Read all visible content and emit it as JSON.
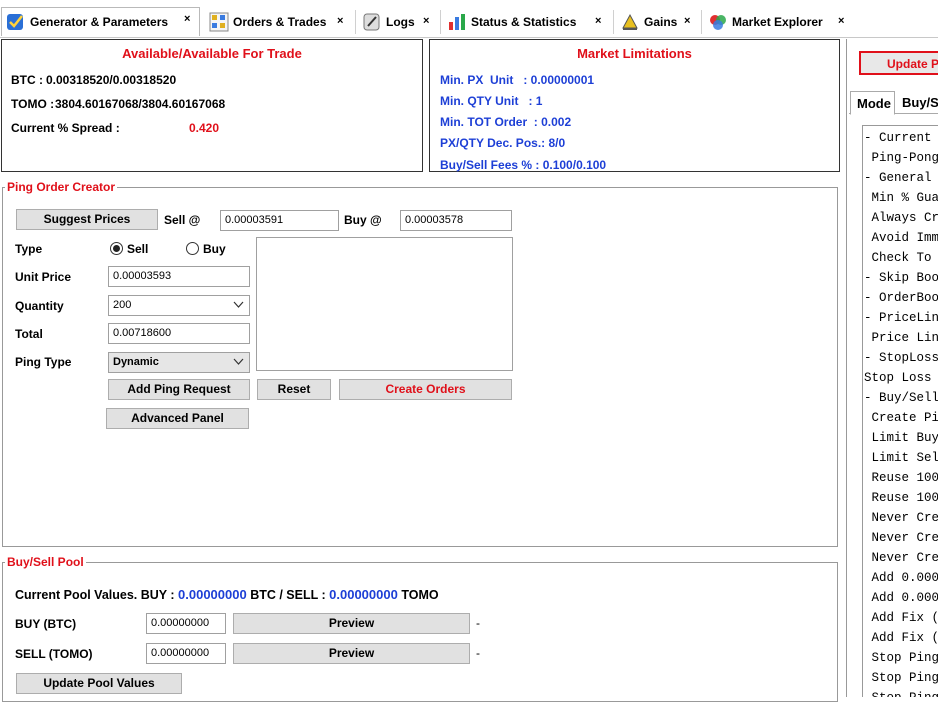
{
  "tabs": [
    {
      "label": "Generator & Parameters",
      "close": "×",
      "active": true,
      "icon": "generator-icon"
    },
    {
      "label": "Orders & Trades",
      "close": "×",
      "active": false,
      "icon": "orders-icon"
    },
    {
      "label": "Logs",
      "close": "×",
      "active": false,
      "icon": "logs-icon"
    },
    {
      "label": "Status & Statistics",
      "close": "×",
      "active": false,
      "icon": "statistics-icon"
    },
    {
      "label": "Gains",
      "close": "×",
      "active": false,
      "icon": "gains-icon"
    },
    {
      "label": "Market Explorer",
      "close": "×",
      "active": false,
      "icon": "market-explorer-icon"
    }
  ],
  "available": {
    "title": "Available/Available For Trade",
    "btc_label": "BTC :",
    "btc_value": "0.00318520/0.00318520",
    "tomo_label": "TOMO :",
    "tomo_value": "3804.60167068/3804.60167068",
    "spread_label": "Current % Spread :",
    "spread_value": "0.420"
  },
  "limitations": {
    "title": "Market Limitations",
    "min_px": "Min. PX  Unit   : 0.00000001",
    "min_qty": "Min. QTY Unit   : 1",
    "min_tot": "Min. TOT Order  : 0.002",
    "decpos": "PX/QTY Dec. Pos.: 8/0",
    "fees": "Buy/Sell Fees % : 0.100/0.100"
  },
  "ping_creator": {
    "title": "Ping Order Creator",
    "suggest_button": "Suggest Prices",
    "sell_at_label": "Sell @",
    "sell_at_value": "0.00003591",
    "buy_at_label": "Buy @",
    "buy_at_value": "0.00003578",
    "type_label": "Type",
    "type_sell": "Sell",
    "type_buy": "Buy",
    "unit_price_label": "Unit Price",
    "unit_price_value": "0.00003593",
    "quantity_label": "Quantity",
    "quantity_value": "200",
    "total_label": "Total",
    "total_value": "0.00718600",
    "ping_type_label": "Ping Type",
    "ping_type_value": "Dynamic",
    "add_ping_button": "Add Ping Request",
    "reset_button": "Reset",
    "create_orders_button": "Create Orders",
    "advanced_button": "Advanced Panel"
  },
  "pool": {
    "title": "Buy/Sell Pool",
    "current_prefix": "Current Pool Values. BUY :",
    "buy_value": "0.00000000",
    "mid_text": "BTC / SELL :",
    "sell_value": "0.00000000",
    "suffix": "TOMO",
    "buy_label": "BUY (BTC)",
    "buy_input": "0.00000000",
    "sell_label": "SELL (TOMO)",
    "sell_input": "0.00000000",
    "preview": "Preview",
    "dash": "-",
    "update_button": "Update Pool Values"
  },
  "right": {
    "update_button": "Update P",
    "tab_mode": "Mode",
    "tab_buysell": "Buy/S",
    "lines": [
      "- Current",
      " Ping-Pong",
      "- General",
      " Min % Gua",
      " Always Cr",
      " Avoid Imm",
      " Check To",
      "- Skip Boo",
      "- OrderBoo",
      "- PriceLin",
      " Price Lin",
      "- StopLoss",
      "Stop Loss",
      "- Buy/Sell",
      " Create Pi",
      " Limit Buy",
      " Limit Sel",
      " Reuse 100",
      " Reuse 100",
      " Never Cre",
      " Never Cre",
      " Never Cre",
      " Add 0.000",
      " Add 0.000",
      " Add Fix (",
      " Add Fix (",
      " Stop Ping",
      " Stop Ping",
      " Stop Ping"
    ]
  },
  "colors": {
    "accent_red": "#e0101a",
    "value_blue": "#1d3fd6"
  }
}
